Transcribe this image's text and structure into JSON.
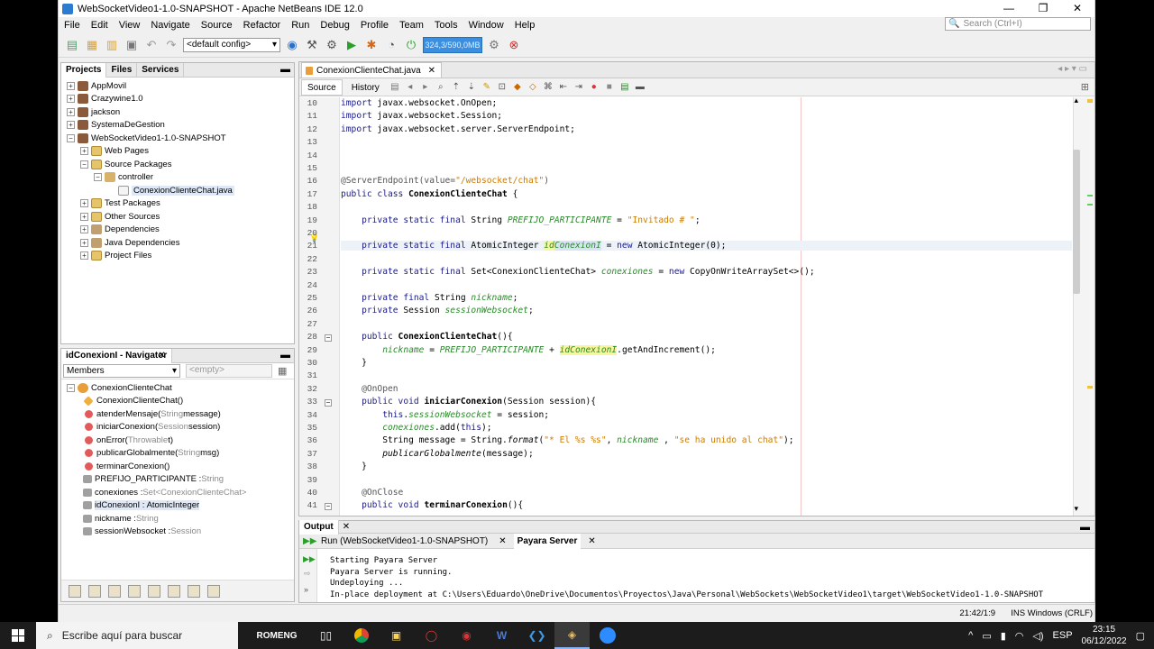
{
  "window": {
    "title": "WebSocketVideo1-1.0-SNAPSHOT - Apache NetBeans IDE 12.0",
    "min": "—",
    "max": "❐",
    "close": "✕"
  },
  "menu": [
    "File",
    "Edit",
    "View",
    "Navigate",
    "Source",
    "Refactor",
    "Run",
    "Debug",
    "Profile",
    "Team",
    "Tools",
    "Window",
    "Help"
  ],
  "search": {
    "placeholder": "Search (Ctrl+I)"
  },
  "toolbar": {
    "config": "<default config>",
    "memory": "324,3/590,0MB"
  },
  "projects": {
    "tabs": [
      "Projects",
      "Files",
      "Services"
    ],
    "items": [
      {
        "label": "AppMovil",
        "level": 0,
        "tog": "+",
        "icon": "proj"
      },
      {
        "label": "Crazywine1.0",
        "level": 0,
        "tog": "+",
        "icon": "proj"
      },
      {
        "label": "jackson",
        "level": 0,
        "tog": "+",
        "icon": "proj"
      },
      {
        "label": "SystemaDeGestion",
        "level": 0,
        "tog": "+",
        "icon": "proj"
      },
      {
        "label": "WebSocketVideo1-1.0-SNAPSHOT",
        "level": 0,
        "tog": "−",
        "icon": "proj"
      },
      {
        "label": "Web Pages",
        "level": 1,
        "tog": "+",
        "icon": "fold"
      },
      {
        "label": "Source Packages",
        "level": 1,
        "tog": "−",
        "icon": "fold"
      },
      {
        "label": "controller",
        "level": 2,
        "tog": "−",
        "icon": "pkg"
      },
      {
        "label": "ConexionClienteChat.java",
        "level": 3,
        "tog": "",
        "icon": "java",
        "selected": true
      },
      {
        "label": "Test Packages",
        "level": 1,
        "tog": "+",
        "icon": "fold"
      },
      {
        "label": "Other Sources",
        "level": 1,
        "tog": "+",
        "icon": "fold"
      },
      {
        "label": "Dependencies",
        "level": 1,
        "tog": "+",
        "icon": "lib"
      },
      {
        "label": "Java Dependencies",
        "level": 1,
        "tog": "+",
        "icon": "lib"
      },
      {
        "label": "Project Files",
        "level": 1,
        "tog": "+",
        "icon": "fold"
      }
    ]
  },
  "navigator": {
    "title": "idConexionI - Navigator",
    "filter": "Members",
    "empty": "<empty>",
    "items": [
      {
        "name": "ConexionClienteChat",
        "type": "",
        "level": 0,
        "icon": "cls"
      },
      {
        "name": "ConexionClienteChat()",
        "type": "",
        "level": 1,
        "icon": "ctor"
      },
      {
        "name": "atenderMensaje(",
        "t2": "String",
        "name2": " message)",
        "level": 1,
        "icon": "m"
      },
      {
        "name": "iniciarConexion(",
        "t2": "Session",
        "name2": " session)",
        "level": 1,
        "icon": "m"
      },
      {
        "name": "onError(",
        "t2": "Throwable",
        "name2": " t)",
        "level": 1,
        "icon": "m"
      },
      {
        "name": "publicarGlobalmente(",
        "t2": "String",
        "name2": " msg)",
        "level": 1,
        "icon": "m"
      },
      {
        "name": "terminarConexion()",
        "level": 1,
        "icon": "m"
      },
      {
        "name": "PREFIJO_PARTICIPANTE : ",
        "t2": "String",
        "level": 1,
        "icon": "f"
      },
      {
        "name": "conexiones : ",
        "t2": "Set<ConexionClienteChat>",
        "level": 1,
        "icon": "f"
      },
      {
        "name": "idConexionI : AtomicInteger",
        "level": 1,
        "icon": "f",
        "selected": true
      },
      {
        "name": "nickname : ",
        "t2": "String",
        "level": 1,
        "icon": "f"
      },
      {
        "name": "sessionWebsocket : ",
        "t2": "Session",
        "level": 1,
        "icon": "f"
      }
    ]
  },
  "editor": {
    "tab": "ConexionClienteChat.java",
    "source": "Source",
    "history": "History"
  },
  "code": [
    {
      "n": "10",
      "html": "<span class=kw>import</span> javax.websocket.OnOpen;"
    },
    {
      "n": "11",
      "html": "<span class=kw>import</span> javax.websocket.Session;"
    },
    {
      "n": "12",
      "html": "<span class=kw>import</span> javax.websocket.server.ServerEndpoint;"
    },
    {
      "n": "13",
      "html": ""
    },
    {
      "n": "14",
      "html": ""
    },
    {
      "n": "15",
      "html": ""
    },
    {
      "n": "16",
      "html": "<span class=ann>@ServerEndpoint(value=</span><span class=str>\"/websocket/chat\"</span><span class=ann>)</span>"
    },
    {
      "n": "17",
      "html": "<span class=kw>public class</span> <b>ConexionClienteChat</b> {"
    },
    {
      "n": "18",
      "html": ""
    },
    {
      "n": "19",
      "html": "    <span class=kw>private static final</span> String <span class=fi>PREFIJO_PARTICIPANTE</span> = <span class=str>\"Invitado # \"</span>;"
    },
    {
      "n": "20",
      "html": ""
    },
    {
      "n": "21",
      "html": "    <span class=kw>private static final</span> AtomicInteger <span class='fi hl'>id<span class=hlb>ConexionI</span></span> = <span class=kw>new</span> AtomicInteger(0);"
    },
    {
      "n": "22",
      "html": ""
    },
    {
      "n": "23",
      "html": "    <span class=kw>private static final</span> Set&lt;ConexionClienteChat&gt; <span class=fi>conexiones</span> = <span class=kw>new</span> CopyOnWriteArraySet&lt;&gt;();"
    },
    {
      "n": "24",
      "html": ""
    },
    {
      "n": "25",
      "html": "    <span class=kw>private final</span> String <span class=fi>nickname</span>;"
    },
    {
      "n": "26",
      "html": "    <span class=kw>private</span> Session <span class=fi>sessionWebsocket</span>;"
    },
    {
      "n": "27",
      "html": ""
    },
    {
      "n": "28",
      "html": "    <span class=kw>public</span> <b>ConexionClienteChat</b>(){"
    },
    {
      "n": "29",
      "html": "        <span class=fi>nickname</span> = <span class=fi>PREFIJO_PARTICIPANTE</span> + <span class='fi hl'>idConexionI</span>.getAndIncrement();"
    },
    {
      "n": "30",
      "html": "    }"
    },
    {
      "n": "31",
      "html": ""
    },
    {
      "n": "32",
      "html": "    <span class=ann>@OnOpen</span>"
    },
    {
      "n": "33",
      "html": "    <span class=kw>public void</span> <b>iniciarConexion</b>(Session session){"
    },
    {
      "n": "34",
      "html": "        <span class=kw>this</span>.<span class=fi>sessionWebsocket</span> = session;"
    },
    {
      "n": "35",
      "html": "        <span class=fi>conexiones</span>.add(<span class=kw>this</span>);"
    },
    {
      "n": "36",
      "html": "        String message = String.<i>format</i>(<span class=str>\"* El %s %s\"</span>, <span class=fi>nickname</span> , <span class=str>\"se ha unido al chat\"</span>);"
    },
    {
      "n": "37",
      "html": "        <i>publicarGlobalmente</i>(message);"
    },
    {
      "n": "38",
      "html": "    }"
    },
    {
      "n": "39",
      "html": ""
    },
    {
      "n": "40",
      "html": "    <span class=ann>@OnClose</span>"
    },
    {
      "n": "41",
      "html": "    <span class=kw>public void</span> <b>terminarConexion</b>(){"
    }
  ],
  "output": {
    "title": "Output",
    "run_tab": "Run (WebSocketVideo1-1.0-SNAPSHOT)",
    "server_tab": "Payara Server",
    "lines": [
      "Starting Payara Server",
      "Payara Server is running.",
      "Undeploying ...",
      "In-place deployment at C:\\Users\\Eduardo\\OneDrive\\Documentos\\Proyectos\\Java\\Personal\\WebSockets\\WebSocketVideo1\\target\\WebSocketVideo1-1.0-SNAPSHOT"
    ]
  },
  "status": {
    "position": "21:42/1:9",
    "ins": "INS Windows (CRLF)"
  },
  "taskbar": {
    "search": "Escribe aquí para buscar",
    "romeng": "ROMENG",
    "lang": "ESP",
    "time": "23:15",
    "date": "06/12/2022"
  }
}
